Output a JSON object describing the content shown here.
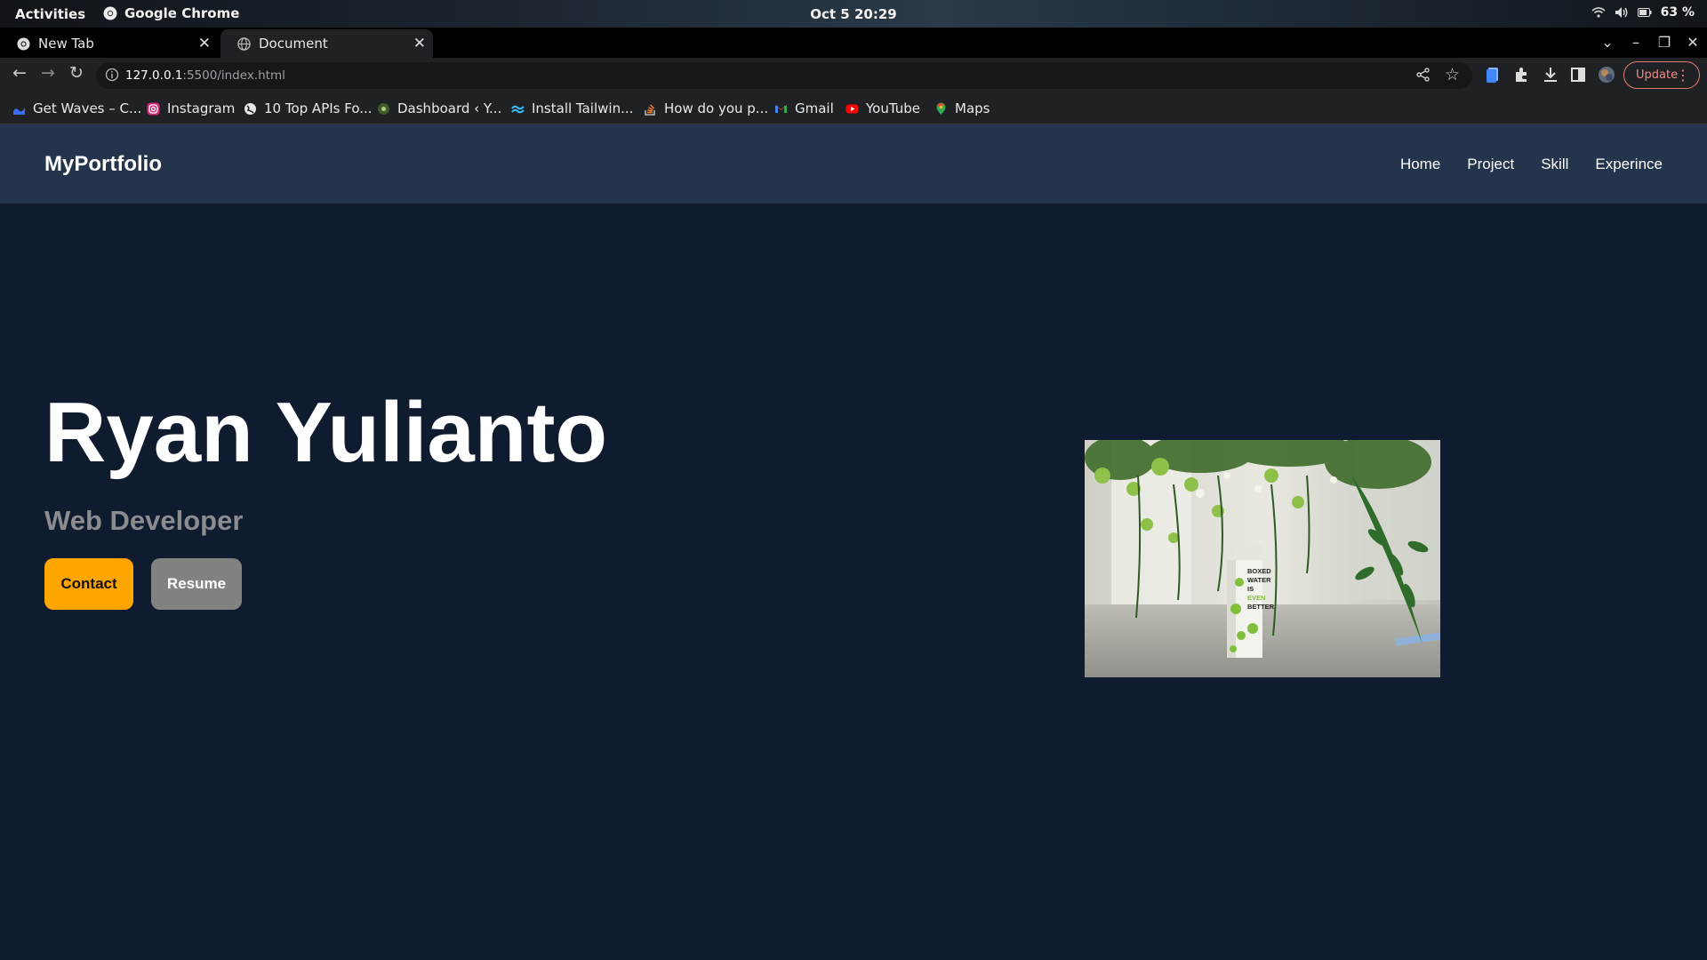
{
  "os_bar": {
    "activities": "Activities",
    "app_name": "Google Chrome",
    "clock": "Oct 5  20:29",
    "battery": "63 %"
  },
  "tabs": [
    {
      "title": "New Tab",
      "active": false
    },
    {
      "title": "Document",
      "active": true
    }
  ],
  "toolbar": {
    "url_host": "127.0.0.1",
    "url_rest": ":5500/index.html",
    "update_label": "Update"
  },
  "bookmarks": [
    {
      "label": "Get Waves – C...",
      "icon": "waves-icon"
    },
    {
      "label": "Instagram",
      "icon": "instagram-icon"
    },
    {
      "label": "10 Top APIs Fo...",
      "icon": "globe-icon"
    },
    {
      "label": "Dashboard ‹ Y...",
      "icon": "dashboard-icon"
    },
    {
      "label": "Install Tailwin...",
      "icon": "tailwind-icon"
    },
    {
      "label": "How do you p...",
      "icon": "stackoverflow-icon"
    },
    {
      "label": "Gmail",
      "icon": "gmail-icon"
    },
    {
      "label": "YouTube",
      "icon": "youtube-icon"
    },
    {
      "label": "Maps",
      "icon": "maps-icon"
    }
  ],
  "site": {
    "logo": "MyPortfolio",
    "nav": [
      "Home",
      "Project",
      "Skill",
      "Experince"
    ],
    "hero_name": "Ryan Yulianto",
    "hero_role": "Web Developer",
    "contact_label": "Contact",
    "resume_label": "Resume",
    "image_text": [
      "BOXED",
      "WATER",
      "IS",
      "EVEN",
      "BETTER."
    ]
  },
  "colors": {
    "page_bg": "#0f1b2e",
    "nav_bg": "#24344d",
    "contact_btn": "#ffa500",
    "resume_btn": "#828282"
  }
}
